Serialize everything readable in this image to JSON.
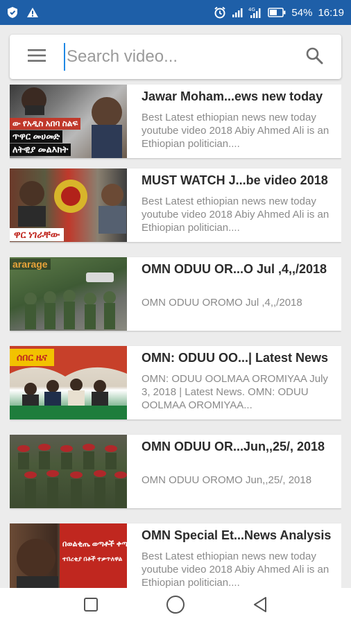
{
  "status_bar": {
    "battery": "54%",
    "time": "16:19",
    "icons": [
      "shield-icon",
      "warning-icon",
      "alarm-icon",
      "signal-icon",
      "network-signal-icon",
      "battery-icon"
    ]
  },
  "search": {
    "placeholder": "Search video...",
    "value": "",
    "menu_icon": "hamburger-menu-icon",
    "search_icon": "search-icon"
  },
  "videos": [
    {
      "title": "Jawar Moham...ews new today",
      "description": "Best Latest ethiopian news new today youtube video 2018 Abiy Ahmed Ali is an Ethiopian politician....",
      "thumb_caption_1": "ው የአዲስ አበባ ስልፍ",
      "thumb_caption_2": "ጥዋር መሀመድ",
      "thumb_caption_3": "ለትዊያ መልእክት"
    },
    {
      "title": "MUST WATCH J...be video 2018",
      "description": "Best Latest ethiopian news new today youtube video 2018 Abiy Ahmed Ali is an Ethiopian politician....",
      "thumb_caption_1": "ዋር ነገራቸው"
    },
    {
      "title": "OMN ODUU OR...O Jul ,4,,/2018",
      "description": "OMN ODUU OROMO Jul ,4,,/2018",
      "thumb_caption_1": "ararage"
    },
    {
      "title": "OMN: ODUU OO...| Latest News",
      "description": "OMN: ODUU OOLMAA OROMIYAA July 3, 2018 | Latest News. OMN: ODUU OOLMAA OROMIYAA...",
      "thumb_caption_1": "ሰበር ዜና"
    },
    {
      "title": "OMN ODUU OR...Jun,,25/, 2018",
      "description": "OMN ODUU OROMO Jun,,25/, 2018"
    },
    {
      "title": "OMN Special Et...News Analysis",
      "description": "Best Latest ethiopian news new today youtube video 2018 Abiy Ahmed Ali is an Ethiopian politician....",
      "thumb_caption_1": "በወልቂጤ ወጣቶች ቀጣ",
      "thumb_caption_2": "ተበረቂያ በቶች ተቃጥለዋል"
    }
  ],
  "nav": {
    "icons": [
      "recent-apps-icon",
      "home-icon",
      "back-icon"
    ]
  },
  "colors": {
    "status_bar": "#1e5fa8",
    "accent": "#1e88e5",
    "background": "#ececec"
  }
}
